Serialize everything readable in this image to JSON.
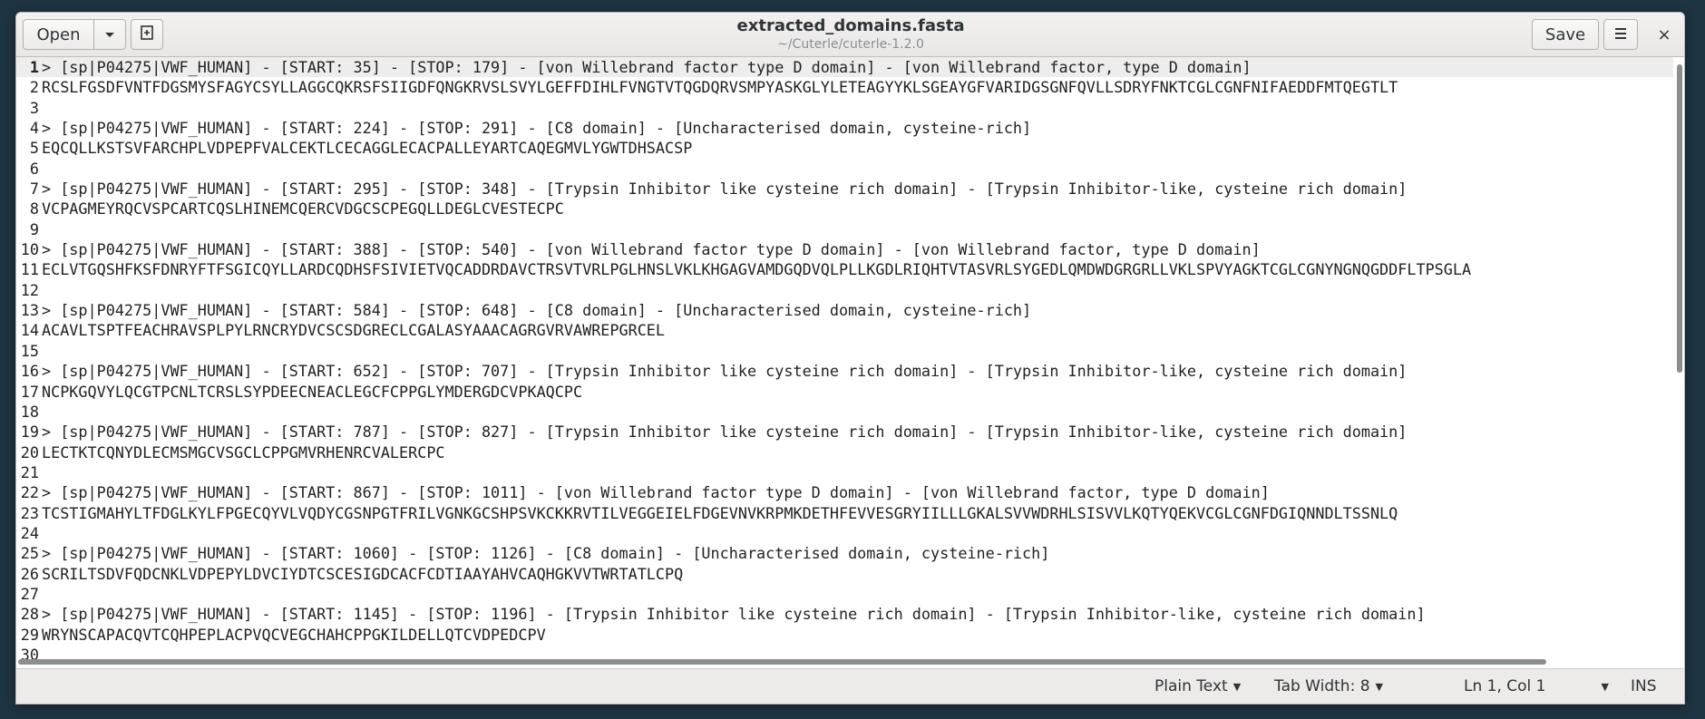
{
  "header": {
    "open_label": "Open",
    "open_menu_icon": "chevron-down-icon",
    "new_tab_icon": "new-document-icon",
    "title": "extracted_domains.fasta",
    "subtitle": "~/Cuterle/cuterle-1.2.0",
    "save_label": "Save",
    "menu_icon": "hamburger-icon",
    "close_glyph": "×"
  },
  "editor": {
    "current_line": 1,
    "lines": [
      {
        "n": "1",
        "t": "> [sp|P04275|VWF_HUMAN] - [START: 35] - [STOP: 179] - [von Willebrand factor type D domain] - [von Willebrand factor, type D domain]"
      },
      {
        "n": "2",
        "t": "RCSLFGSDFVNTFDGSMYSFAGYCSYLLAGGCQKRSFSIIGDFQNGKRVSLSVYLGEFFDIHLFVNGTVTQGDQRVSMPYASKGLYLETEAGYYKLSGEAYGFVARIDGSGNFQVLLSDRYFNKTCGLCGNFNIFAEDDFMTQEGTLT"
      },
      {
        "n": "3",
        "t": ""
      },
      {
        "n": "4",
        "t": "> [sp|P04275|VWF_HUMAN] - [START: 224] - [STOP: 291] - [C8 domain] - [Uncharacterised domain, cysteine-rich]"
      },
      {
        "n": "5",
        "t": "EQCQLLKSTSVFARCHPLVDPEPFVALCEKTLCECAGGLECACPALLEYARTCAQEGMVLYGWTDHSACSP"
      },
      {
        "n": "6",
        "t": ""
      },
      {
        "n": "7",
        "t": "> [sp|P04275|VWF_HUMAN] - [START: 295] - [STOP: 348] - [Trypsin Inhibitor like cysteine rich domain] - [Trypsin Inhibitor-like, cysteine rich domain]"
      },
      {
        "n": "8",
        "t": "VCPAGMEYRQCVSPCARTCQSLHINEMCQERCVDGCSCPEGQLLDEGLCVESTECPC"
      },
      {
        "n": "9",
        "t": ""
      },
      {
        "n": "10",
        "t": "> [sp|P04275|VWF_HUMAN] - [START: 388] - [STOP: 540] - [von Willebrand factor type D domain] - [von Willebrand factor, type D domain]"
      },
      {
        "n": "11",
        "t": "ECLVTGQSHFKSFDNRYFTFSGICQYLLARDCQDHSFSIVIETVQCADDRDAVCTRSVTVRLPGLHNSLVKLKHGAGVAMDGQDVQLPLLKGDLRIQHTVTASVRLSYGEDLQMDWDGRGRLLVKLSPVYAGKTCGLCGNYNGNQGDDFLTPSGLA"
      },
      {
        "n": "12",
        "t": ""
      },
      {
        "n": "13",
        "t": "> [sp|P04275|VWF_HUMAN] - [START: 584] - [STOP: 648] - [C8 domain] - [Uncharacterised domain, cysteine-rich]"
      },
      {
        "n": "14",
        "t": "ACAVLTSPTFEACHRAVSPLPYLRNCRYDVCSCSDGRECLCGALASYAAACAGRGVRVAWREPGRCEL"
      },
      {
        "n": "15",
        "t": ""
      },
      {
        "n": "16",
        "t": "> [sp|P04275|VWF_HUMAN] - [START: 652] - [STOP: 707] - [Trypsin Inhibitor like cysteine rich domain] - [Trypsin Inhibitor-like, cysteine rich domain]"
      },
      {
        "n": "17",
        "t": "NCPKGQVYLQCGTPCNLTCRSLSYPDEECNEACLEGCFCPPGLYMDERGDCVPKAQCPC"
      },
      {
        "n": "18",
        "t": ""
      },
      {
        "n": "19",
        "t": "> [sp|P04275|VWF_HUMAN] - [START: 787] - [STOP: 827] - [Trypsin Inhibitor like cysteine rich domain] - [Trypsin Inhibitor-like, cysteine rich domain]"
      },
      {
        "n": "20",
        "t": "LECTKTCQNYDLECMSMGCVSGCLCPPGMVRHENRCVALERCPC"
      },
      {
        "n": "21",
        "t": ""
      },
      {
        "n": "22",
        "t": "> [sp|P04275|VWF_HUMAN] - [START: 867] - [STOP: 1011] - [von Willebrand factor type D domain] - [von Willebrand factor, type D domain]"
      },
      {
        "n": "23",
        "t": "TCSTIGMAHYLTFDGLKYLFPGECQYVLVQDYCGSNPGTFRILVGNKGCSHPSVKCKKRVTILVEGGEIELFDGEVNVKRPMKDETHFEVVESGRYIILLLGKALSVVWDRHLSISVVLKQTYQEKVCGLCGNFDGIQNNDLTSSNLQ"
      },
      {
        "n": "24",
        "t": ""
      },
      {
        "n": "25",
        "t": "> [sp|P04275|VWF_HUMAN] - [START: 1060] - [STOP: 1126] - [C8 domain] - [Uncharacterised domain, cysteine-rich]"
      },
      {
        "n": "26",
        "t": "SCRILTSDVFQDCNKLVDPEPYLDVCIYDTCSCESIGDCACFCDTIAAYAHVCAQHGKVVTWRTATLCPQ"
      },
      {
        "n": "27",
        "t": ""
      },
      {
        "n": "28",
        "t": "> [sp|P04275|VWF_HUMAN] - [START: 1145] - [STOP: 1196] - [Trypsin Inhibitor like cysteine rich domain] - [Trypsin Inhibitor-like, cysteine rich domain]"
      },
      {
        "n": "29",
        "t": "WRYNSCAPACQVTCQHPEPLACPVQCVEGCHAHCPPGKILDELLQTCVDPEDCPV"
      },
      {
        "n": "30",
        "t": ""
      }
    ]
  },
  "statusbar": {
    "language": "Plain Text",
    "tab_width": "Tab Width: 8",
    "position": "Ln 1, Col 1",
    "mode": "INS"
  }
}
